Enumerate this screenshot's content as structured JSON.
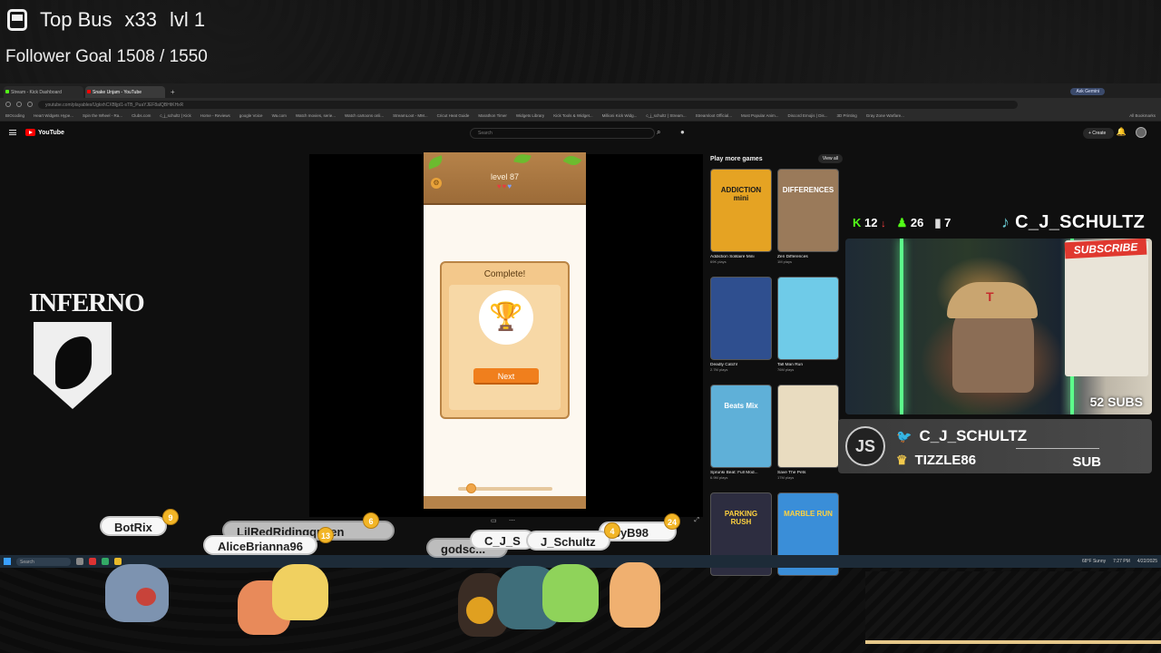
{
  "stream": {
    "top_bus_label": "Top Bus",
    "top_bus_multiplier": "x33",
    "top_bus_level": "lvl 1",
    "follower_goal": "Follower Goal 1508 / 1550"
  },
  "browser": {
    "tabs": [
      {
        "label": "Stream - Kick Dashboard"
      },
      {
        "label": "Snake Unjam - YouTube"
      }
    ],
    "url": "youtube.com/playables/UgkxhCXBljpl1-sTB_PuaYJEF8alQBHtKHxR",
    "bookmarks": [
      "BIOcoding",
      "Heart Widgets Hype...",
      "Spin the Wheel - Ra...",
      "Clubs.com",
      "c_j_schultz | Kick",
      "Home - Reviews",
      "google Voice",
      "Wa.com",
      "Watch movies, serie...",
      "Watch cartoons onli...",
      "StreamLoot - MM...",
      "Cricut Heat Guide",
      "Marathon Timer",
      "Widgets Library",
      "Kick Tools & Widget...",
      "Millioni Kick Widg...",
      "c_j_schultz | Stream...",
      "Streamloot Official...",
      "Most Popular Anim...",
      "Discord Emojis | Dis...",
      "3D Printing",
      "Gray Zone Warfare..."
    ],
    "ask_gemini": "Ask Gemini",
    "all_bookmarks": "All Bookmarks"
  },
  "youtube": {
    "logo_text": "YouTube",
    "search_placeholder": "Search",
    "create_label": "+ Create"
  },
  "game": {
    "level_label": "level 87",
    "hearts_full": "♥♥",
    "hearts_empty": "♥",
    "complete_title": "Complete!",
    "next_label": "Next",
    "slider_level": 0.1
  },
  "games_panel": {
    "title": "Play more games",
    "view_all": "View all",
    "cards": [
      {
        "title": "Addiction Solitaire Mini",
        "sub": "69K plays",
        "thumb_text": "ADDICTION mini",
        "bg": "#e5a323",
        "fg": "#1b1b1b"
      },
      {
        "title": "Zen Differences",
        "sub": "1M plays",
        "thumb_text": "DIFFERENCES",
        "bg": "#9a7a5a",
        "fg": "#fff"
      },
      {
        "title": "Deadly Catch!",
        "sub": "2.7M plays",
        "thumb_text": "",
        "bg": "#2f4f8f",
        "fg": "#fff"
      },
      {
        "title": "Tall Man Run",
        "sub": "76M plays",
        "thumb_text": "",
        "bg": "#6fcbe8",
        "fg": "#fff"
      },
      {
        "title": "Sprunki Beat: Full Mod...",
        "sub": "6.9M plays",
        "thumb_text": "Beats Mix",
        "bg": "#5fb0d8",
        "fg": "#fff"
      },
      {
        "title": "Save The Pets",
        "sub": "17M plays",
        "thumb_text": "",
        "bg": "#e9dcc0",
        "fg": "#333"
      },
      {
        "title": "",
        "sub": "",
        "thumb_text": "PARKING RUSH",
        "bg": "#2d2d40",
        "fg": "#ffd23f"
      },
      {
        "title": "",
        "sub": "",
        "thumb_text": "MARBLE RUN",
        "bg": "#3a8ed8",
        "fg": "#ffd23f"
      }
    ]
  },
  "overlay": {
    "kick_count": "12",
    "followers_count": "26",
    "viewers_count": "7",
    "handle": "C_J_SCHULTZ",
    "subscribe_sticker": "SUBSCRIBE",
    "subs_label": "52 SUBS",
    "plate_name": "C_J_SCHULTZ",
    "plate_sub_name": "TIZZLE86",
    "plate_sub_tag": "SUB",
    "plate_logo": "JS"
  },
  "inferno": {
    "text": "INFERNO"
  },
  "taskbar": {
    "search_placeholder": "Search",
    "weather": "68°F Sunny",
    "time": "7:27 PM",
    "date": "4/22/2025"
  },
  "chat_bar": {
    "names": [
      {
        "name": "BotRix",
        "level": "9"
      },
      {
        "name": "LilRedRidingqueen",
        "level": "6"
      },
      {
        "name": "AliceBrianna96",
        "level": "13"
      },
      {
        "name": "godsc...",
        "level": ""
      },
      {
        "name": "C_J_S",
        "level": ""
      },
      {
        "name": "J_Schultz",
        "level": "4"
      },
      {
        "name": "byB98",
        "level": "24"
      }
    ]
  }
}
